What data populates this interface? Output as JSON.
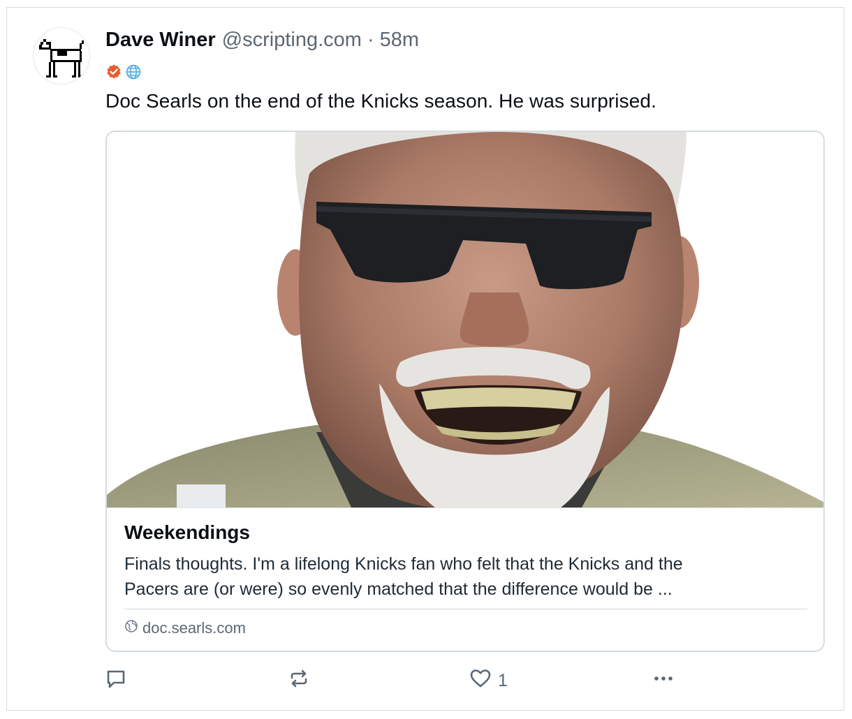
{
  "post": {
    "author": {
      "display_name": "Dave Winer",
      "handle": "@scripting.com",
      "avatar_icon": "dog-icon"
    },
    "separator": "·",
    "timestamp": "58m",
    "badges": [
      {
        "icon": "verified-check-icon",
        "color": "#ec5a2c"
      },
      {
        "icon": "globe-icon",
        "color": "#4aa8e0"
      }
    ],
    "text": "Doc Searls on the end of the Knicks season. He was surprised.",
    "link_card": {
      "image_alt": "photo-of-smiling-man-with-sunglasses",
      "title": "Weekendings",
      "description_lines": [
        "Finals thoughts. I'm a lifelong Knicks fan who felt that the Knicks and the",
        "Pacers are (or were) so evenly matched that the difference would be ..."
      ],
      "domain": "doc.searls.com"
    },
    "actions": {
      "reply_count": "",
      "repost_count": "",
      "like_count": "1"
    }
  },
  "colors": {
    "text_primary": "#0b0f14",
    "text_secondary": "#5b6773",
    "border": "#d4dbe2"
  }
}
